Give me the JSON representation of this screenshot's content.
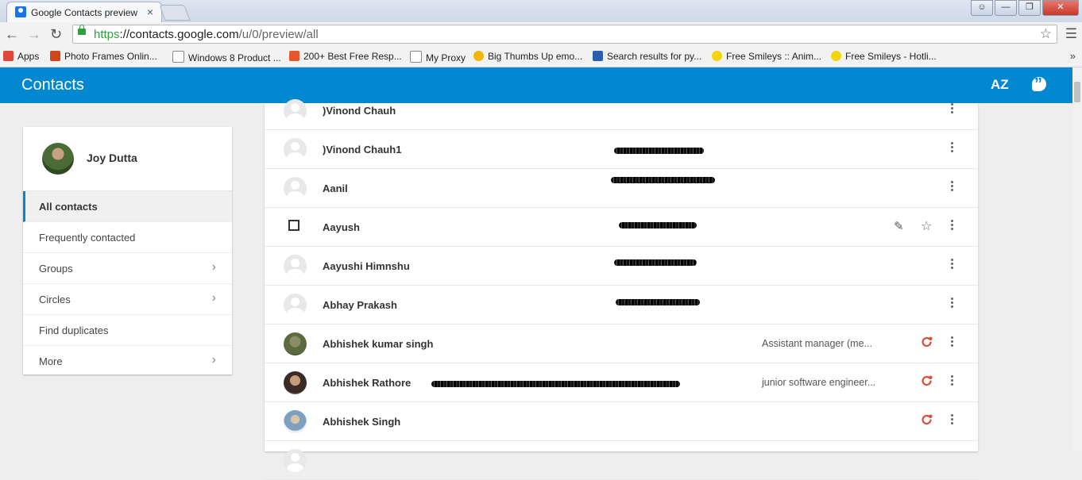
{
  "browser": {
    "tab_title": "Google Contacts preview",
    "tab_close": "×",
    "url_scheme": "https",
    "url_host": "://contacts.google.com",
    "url_path": "/u/0/preview/all",
    "bookmarks": [
      {
        "label": "Apps",
        "icon": "apps-grid-icon",
        "color": "#e0473a"
      },
      {
        "label": "Photo Frames Onlin...",
        "icon": "photo-frame-icon",
        "color": "#d0451b"
      },
      {
        "label": "Windows 8 Product ...",
        "icon": "page-icon",
        "color": "#ffffff"
      },
      {
        "label": "200+ Best Free Resp...",
        "icon": "c-logo-icon",
        "color": "#e4572e"
      },
      {
        "label": "My Proxy",
        "icon": "page-icon",
        "color": "#ffffff"
      },
      {
        "label": "Big Thumbs Up emo...",
        "icon": "smiley-icon",
        "color": "#f2b60a"
      },
      {
        "label": "Search results for py...",
        "icon": "m-logo-icon",
        "color": "#2a5db0"
      },
      {
        "label": "Free Smileys :: Anim...",
        "icon": "smiley-icon",
        "color": "#f2d60a"
      },
      {
        "label": "Free Smileys - Hotli...",
        "icon": "smiley-icon",
        "color": "#f2d60a"
      }
    ],
    "bookmarks_more": "»"
  },
  "app": {
    "title": "Contacts",
    "sort_label": "AZ",
    "accent_color": "#0288d1",
    "gplus_color": "#dd4b39"
  },
  "sidebar": {
    "profile_name": "Joy Dutta",
    "items": [
      {
        "label": "All contacts",
        "active": true,
        "chevron": false
      },
      {
        "label": "Frequently contacted",
        "active": false,
        "chevron": false
      },
      {
        "label": "Groups",
        "active": false,
        "chevron": true
      },
      {
        "label": "Circles",
        "active": false,
        "chevron": true
      },
      {
        "label": "Find duplicates",
        "active": false,
        "chevron": false
      },
      {
        "label": "More",
        "active": false,
        "chevron": true
      }
    ]
  },
  "contacts": [
    {
      "name": ")Vinond Chauh",
      "job": "",
      "avatar": "placeholder",
      "gplus": false,
      "redacted": false
    },
    {
      "name": ")Vinond Chauh1",
      "job": "",
      "avatar": "placeholder",
      "gplus": false,
      "redacted": true
    },
    {
      "name": "Aanil",
      "job": "",
      "avatar": "placeholder",
      "gplus": false,
      "redacted": true
    },
    {
      "name": "Aayush",
      "job": "",
      "avatar": "checkbox",
      "gplus": false,
      "redacted": true,
      "hovered": true
    },
    {
      "name": "Aayushi Himnshu",
      "job": "",
      "avatar": "placeholder",
      "gplus": false,
      "redacted": true
    },
    {
      "name": "Abhay Prakash",
      "job": "",
      "avatar": "placeholder",
      "gplus": false,
      "redacted": true
    },
    {
      "name": "Abhishek kumar singh",
      "job": "Assistant manager (me...",
      "avatar": "photo1",
      "gplus": true,
      "redacted": false
    },
    {
      "name": "Abhishek Rathore",
      "job": "junior software engineer...",
      "avatar": "photo2",
      "gplus": true,
      "redacted": true
    },
    {
      "name": "Abhishek Singh",
      "job": "",
      "avatar": "photo3",
      "gplus": true,
      "redacted": false
    },
    {
      "name": "",
      "job": "",
      "avatar": "placeholder",
      "gplus": false,
      "redacted": false
    }
  ]
}
